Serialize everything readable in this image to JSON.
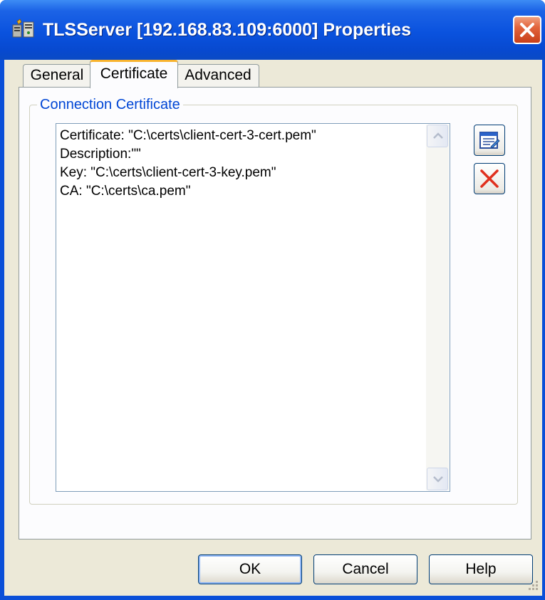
{
  "window": {
    "title": "TLSServer [192.168.83.109:6000] Properties",
    "icon": "server-network-icon",
    "close_icon": "close-icon"
  },
  "tabs": [
    {
      "label": "General",
      "active": false
    },
    {
      "label": "Certificate",
      "active": true
    },
    {
      "label": "Advanced",
      "active": false
    }
  ],
  "certificate": {
    "group_label": "Connection Certificate",
    "lines": [
      "Certificate: \"C:\\certs\\client-cert-3-cert.pem\"",
      "Description:\"\"",
      "Key: \"C:\\certs\\client-cert-3-key.pem\"",
      "CA: \"C:\\certs\\ca.pem\""
    ],
    "edit_icon": "edit-icon",
    "delete_icon": "delete-icon"
  },
  "buttons": {
    "ok": "OK",
    "cancel": "Cancel",
    "help": "Help"
  },
  "colors": {
    "titlebar": "#0a52de",
    "accent_tab": "#f8b32e",
    "group_label": "#0046d5",
    "close": "#e2643c",
    "delete": "#e0301e"
  }
}
